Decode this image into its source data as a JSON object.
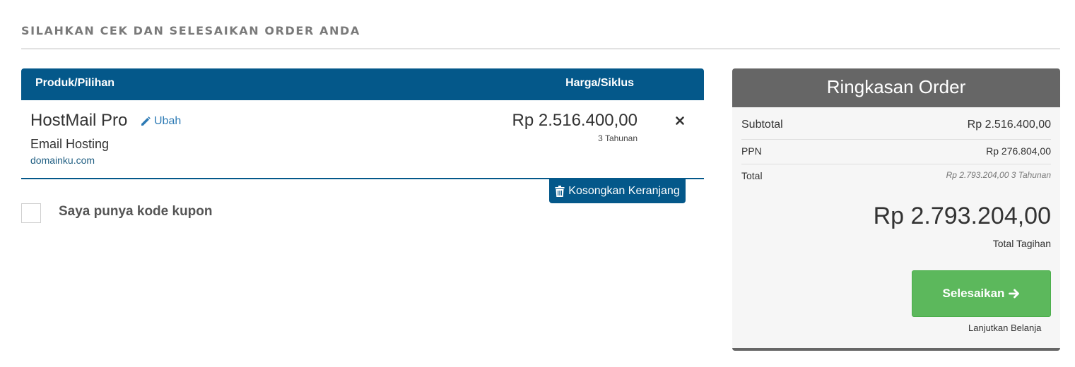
{
  "page": {
    "heading": "SILAHKAN CEK DAN SELESAIKAN ORDER ANDA"
  },
  "cart": {
    "header": {
      "product_col": "Produk/Pilihan",
      "price_col": "Harga/Siklus"
    },
    "items": [
      {
        "name": "HostMail Pro",
        "edit_label": "Ubah",
        "group": "Email Hosting",
        "domain": "domainku.com",
        "price": "Rp 2.516.400,00",
        "cycle": "3 Tahunan",
        "remove_icon": "close-icon"
      }
    ],
    "empty_cart_label": "Kosongkan Keranjang",
    "coupon_label": "Saya punya kode kupon"
  },
  "summary": {
    "title": "Ringkasan Order",
    "subtotal_label": "Subtotal",
    "subtotal_value": "Rp 2.516.400,00",
    "tax_label": "PPN",
    "tax_value": "Rp 276.804,00",
    "total_label": "Total",
    "total_value": "Rp 2.793.204,00 3 Tahunan",
    "grand_total": "Rp 2.793.204,00",
    "grand_total_label": "Total Tagihan",
    "checkout_label": "Selesaikan",
    "continue_label": "Lanjutkan Belanja"
  },
  "colors": {
    "primary": "#04588a",
    "summary_header": "#666666",
    "checkout": "#5cb85c",
    "link": "#2e7bb5"
  }
}
